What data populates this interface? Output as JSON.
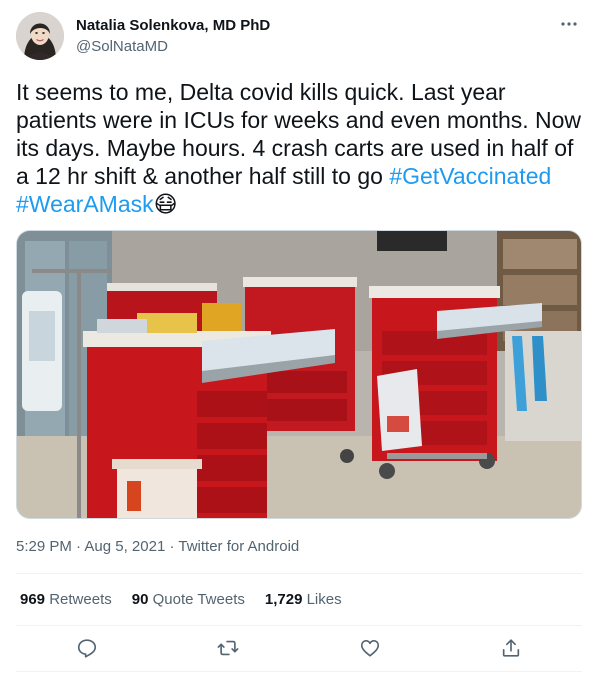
{
  "author": {
    "name": "Natalia Solenkova, MD PhD",
    "handle": "@SolNataMD"
  },
  "tweet": {
    "text_main": "It seems to me, Delta covid kills quick. Last year patients were in ICUs for weeks and even months. Now its days. Maybe hours. 4 crash carts are used in half of a 12 hr shift & another half still to go ",
    "hashtag_1": "#GetVaccinated",
    "hashtag_2": "#WearAMask",
    "emoji": "😷"
  },
  "meta": {
    "time": "5:29 PM",
    "sep1": " · ",
    "date": "Aug 5, 2021",
    "sep2": " · ",
    "source": "Twitter for Android"
  },
  "stats": {
    "retweets_count": "969",
    "retweets_label": "Retweets",
    "quote_count": "90",
    "quote_label": "Quote Tweets",
    "likes_count": "1,729",
    "likes_label": "Likes"
  },
  "colors": {
    "link": "#1d9bf0",
    "secondary_text": "#536471",
    "cart_red": "#c8161d"
  },
  "icons": [
    "more-icon",
    "reply-icon",
    "retweet-icon",
    "like-icon",
    "share-icon"
  ]
}
